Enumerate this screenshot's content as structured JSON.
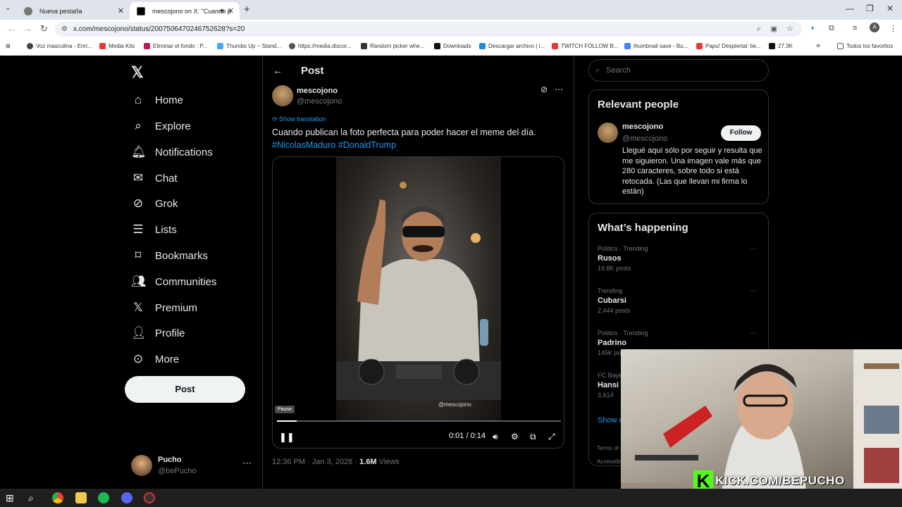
{
  "browser": {
    "tabs": [
      {
        "title": "Nueva pestaña",
        "active": false
      },
      {
        "title": "mescojono on X: \"Cuando p",
        "active": true
      }
    ],
    "url": "x.com/mescojono/status/2007506470246752628?s=20",
    "bookmarks": [
      "Voz masculina - Enri...",
      "Media Kits",
      "Eliminar el fondo : P...",
      "Thumbs Up ~ Stand...",
      "https://media.discor...",
      "Random picker whe...",
      "Downloads",
      "Descargar archivo | i...",
      "TWITCH FOLLOW B...",
      "thumbnail save - Bu...",
      "Papu! Despiertal: tie...",
      "27.3K",
      "Todos los favoritos"
    ],
    "profile_initial": "A"
  },
  "sidebar": {
    "items": [
      {
        "label": "Home",
        "icon": "home-icon"
      },
      {
        "label": "Explore",
        "icon": "search-icon"
      },
      {
        "label": "Notifications",
        "icon": "bell-icon"
      },
      {
        "label": "Chat",
        "icon": "mail-icon"
      },
      {
        "label": "Grok",
        "icon": "grok-icon"
      },
      {
        "label": "Lists",
        "icon": "list-icon"
      },
      {
        "label": "Bookmarks",
        "icon": "bookmark-icon"
      },
      {
        "label": "Communities",
        "icon": "people-icon"
      },
      {
        "label": "Premium",
        "icon": "x-logo-icon"
      },
      {
        "label": "Profile",
        "icon": "person-icon"
      },
      {
        "label": "More",
        "icon": "more-circle-icon"
      }
    ],
    "post_button": "Post",
    "account": {
      "name": "Pucho",
      "handle": "@bePucho"
    }
  },
  "main": {
    "header": "Post",
    "author": {
      "name": "mescojono",
      "handle": "@mescojono"
    },
    "translate": "Show translation",
    "text": "Cuando publican la foto perfecta para poder hacer el meme del día.",
    "hashtags": [
      "#NicolasMaduro",
      "#DonaldTrump"
    ],
    "video": {
      "watermark": "@mescojono",
      "tooltip": "Pause",
      "time": "0:01 / 0:14",
      "progress_fraction": 0.07
    },
    "meta": {
      "time": "12:36 PM · Jan 3, 2026 · ",
      "views": "1.6M",
      "views_label": " Views"
    }
  },
  "right": {
    "search_placeholder": "Search",
    "relevant": {
      "title": "Relevant people",
      "name": "mescojono",
      "handle": "@mescojono",
      "follow": "Follow",
      "bio": "Llegué aquí sólo por seguir y resulta que me siguieron. Una imagen vale más que 280 caracteres, sobre todo si está retocada. (Las que llevan mi firma lo están)"
    },
    "happening": {
      "title": "What’s happening",
      "trends": [
        {
          "category": "Politics · Trending",
          "name": "Rusos",
          "count": "19.8K posts"
        },
        {
          "category": "Trending",
          "name": "Cubarsi",
          "count": "2,444 posts"
        },
        {
          "category": "Politics · Trending",
          "name": "Padrino",
          "count": "145K posts"
        },
        {
          "category": "FC Baye",
          "name": "Hansi",
          "count": "3,614"
        }
      ],
      "show_more": "Show m"
    },
    "footer": [
      "Terms of S",
      "Accessibil"
    ]
  },
  "overlay": {
    "kick_text": "KICK.COM/BEPUCHO",
    "kick_letter": "K"
  }
}
